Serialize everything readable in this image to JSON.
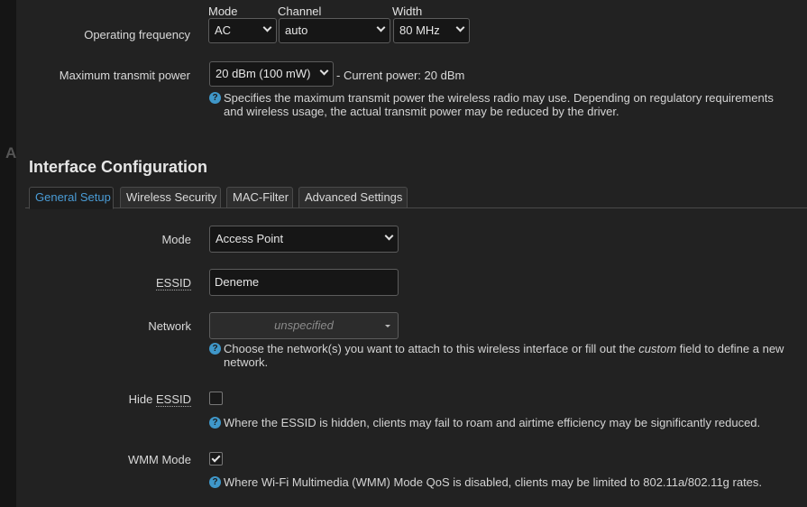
{
  "radio": {
    "operating_frequency_label": "Operating frequency",
    "mode_header": "Mode",
    "channel_header": "Channel",
    "width_header": "Width",
    "mode_value": "AC",
    "channel_value": "auto",
    "width_value": "80 MHz",
    "tx_power_label": "Maximum transmit power",
    "tx_power_value": "20 dBm (100 mW)",
    "current_power": "- Current power: 20 dBm",
    "tx_power_help": "Specifies the maximum transmit power the wireless radio may use. Depending on regulatory requirements and wireless usage, the actual transmit power may be reduced by the driver."
  },
  "interface": {
    "title": "Interface Configuration",
    "tabs": [
      {
        "label": "General Setup",
        "active": true
      },
      {
        "label": "Wireless Security",
        "active": false
      },
      {
        "label": "MAC-Filter",
        "active": false
      },
      {
        "label": "Advanced Settings",
        "active": false
      }
    ],
    "mode_label": "Mode",
    "mode_value": "Access Point",
    "essid_label": "ESSID",
    "essid_value": "Deneme",
    "network_label": "Network",
    "network_value": "unspecified",
    "network_help_pre": "Choose the network(s) you want to attach to this wireless interface or fill out the ",
    "network_help_em": "custom",
    "network_help_post": " field to define a new network.",
    "hide_essid_label_prefix": "Hide ",
    "hide_essid_label_word": "ESSID",
    "hide_essid_checked": false,
    "hide_essid_help": "Where the ESSID is hidden, clients may fail to roam and airtime efficiency may be significantly reduced.",
    "wmm_label": "WMM Mode",
    "wmm_checked": true,
    "wmm_help": "Where Wi-Fi Multimedia (WMM) Mode QoS is disabled, clients may be limited to 802.11a/802.11g rates."
  },
  "icons": {
    "help": "?",
    "help_color": "#3f97c9",
    "active_tab_color": "#4a9cd6"
  }
}
